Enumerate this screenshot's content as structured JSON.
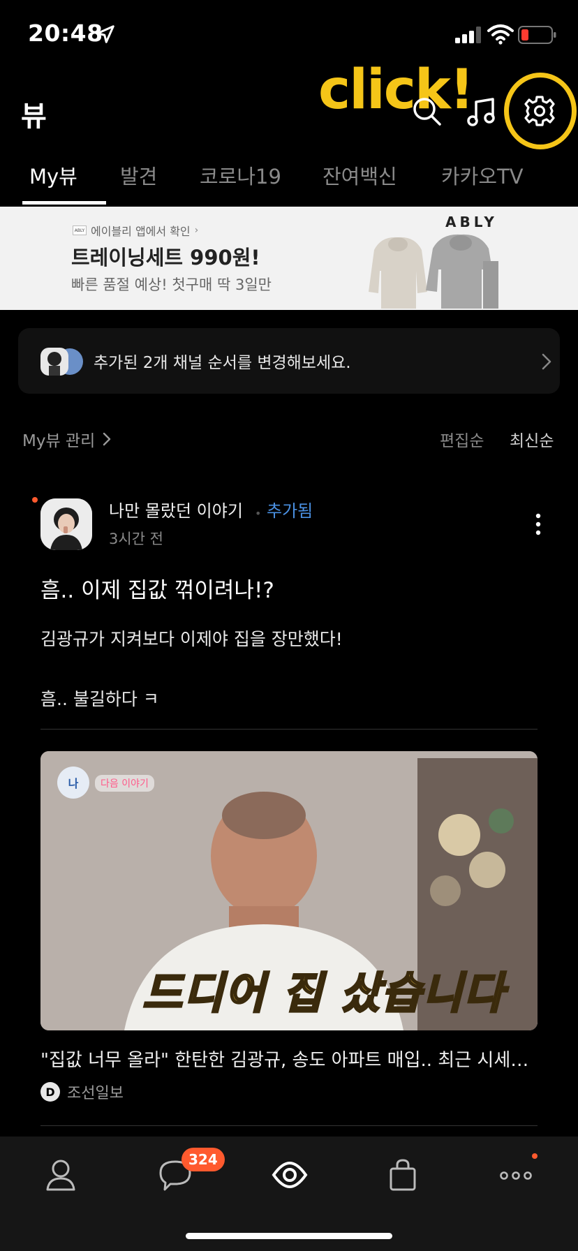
{
  "status": {
    "time": "20:48"
  },
  "header": {
    "title": "뷰",
    "annotation": "click!"
  },
  "tabs": [
    {
      "label": "My뷰",
      "active": true
    },
    {
      "label": "발견"
    },
    {
      "label": "코로나19"
    },
    {
      "label": "잔여백신"
    },
    {
      "label": "카카오TV"
    }
  ],
  "ad": {
    "source": "에이블리 앱에서 확인",
    "small_logo": "ABLY",
    "title": "트레이닝세트 990원!",
    "subtitle": "빠른 품절 예상! 첫구매 딱 3일만",
    "brand": "ABLY"
  },
  "notice": {
    "text": "추가된 2개 채널 순서를 변경해보세요."
  },
  "manage": {
    "label": "My뷰 관리",
    "sort_edit": "편집순",
    "sort_recent": "최신순"
  },
  "post": {
    "channel_name": "나만 몰랐던 이야기",
    "added_label": "추가됨",
    "time_ago": "3시간 전",
    "title": "흠.. 이제 집값 꺾이려나!?",
    "body_line1": "김광규가 지켜보다 이제야 집을 장만했다!",
    "body_line2": "흠.. 불길하다 ㅋ",
    "thumb_badge": "다음 이야기",
    "thumb_caption": "드디어 집 샀습니다",
    "article_title": "\"집값 너무 올라\" 한탄한 김광규, 송도 아파트 매입.. 최근 시세…",
    "source_initial": "D",
    "source_name": "조선일보"
  },
  "bottom_nav": {
    "chat_badge": "324"
  },
  "colors": {
    "accent_yellow": "#f5c518",
    "badge_orange": "#ff5a2e",
    "added_blue": "#4a90e2"
  }
}
